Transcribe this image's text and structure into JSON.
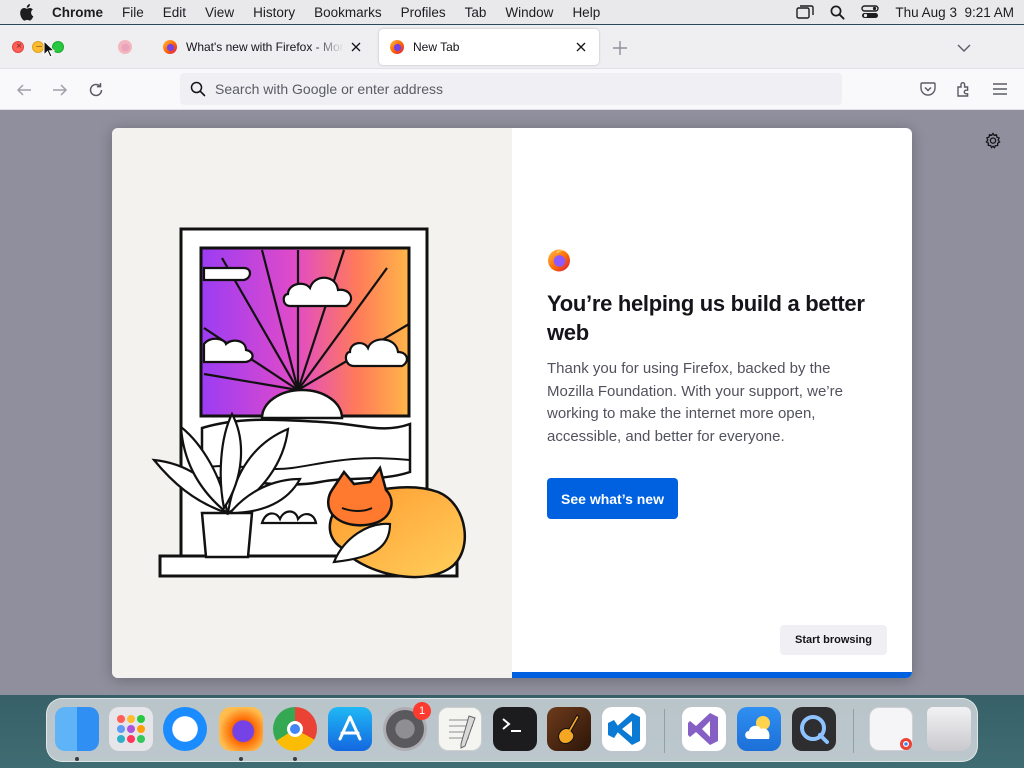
{
  "menubar": {
    "app_name": "Chrome",
    "items": [
      "File",
      "Edit",
      "View",
      "History",
      "Bookmarks",
      "Profiles",
      "Tab",
      "Window",
      "Help"
    ],
    "clock": "Thu Aug 3  9:21 AM",
    "status_icons": [
      "stage-manager-icon",
      "spotlight-search-icon",
      "control-center-icon"
    ]
  },
  "tabs": [
    {
      "title": "What's new with Firefox - More",
      "favicon": "firefox-icon",
      "active": false
    },
    {
      "title": "New Tab",
      "favicon": "firefox-icon",
      "active": true
    }
  ],
  "urlbar": {
    "placeholder": "Search with Google or enter address",
    "value": ""
  },
  "toolbar": {
    "icons": [
      "pocket-icon",
      "extensions-icon",
      "app-menu-icon"
    ]
  },
  "modal": {
    "title": "You’re helping us build a better web",
    "body": "Thank you for using Firefox, backed by the Mozilla Foundation. With your support, we’re working to make the internet more open, accessible, and better for everyone.",
    "primary_button": "See what’s new",
    "secondary_button": "Start browsing",
    "progress": 1.0
  },
  "colors": {
    "accent": "#0061e0",
    "content_overlay": "#8f8f9d",
    "illustration_bg": "#f3f2ef"
  },
  "dock": {
    "apps": [
      "Finder",
      "Launchpad",
      "Safari",
      "Firefox",
      "Google Chrome",
      "App Store",
      "System Settings",
      "TextEdit",
      "Terminal",
      "GarageBand",
      "Visual Studio Code",
      "Visual Studio",
      "iCloud Weather",
      "QuickTime Player",
      "Downloads",
      "Trash"
    ],
    "settings_badge": "1"
  }
}
